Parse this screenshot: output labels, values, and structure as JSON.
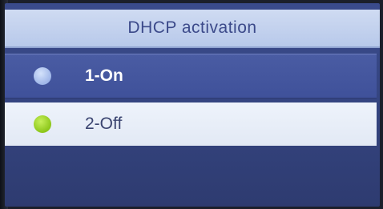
{
  "header": {
    "title": "DHCP activation"
  },
  "menu": {
    "items": [
      {
        "label": "1-On",
        "dot_icon": "radio-dot-icon",
        "dot_color": "#a9bfee",
        "state": "unselected"
      },
      {
        "label": "2-Off",
        "dot_icon": "radio-dot-icon",
        "dot_color": "#8cc61a",
        "state": "selected"
      }
    ]
  },
  "colors": {
    "screen_background": "#34447f",
    "title_bar": "#c5d4ef",
    "title_text": "#3c4a8a",
    "highlight_row": "#e8eef8",
    "normal_row": "#4556a0"
  }
}
